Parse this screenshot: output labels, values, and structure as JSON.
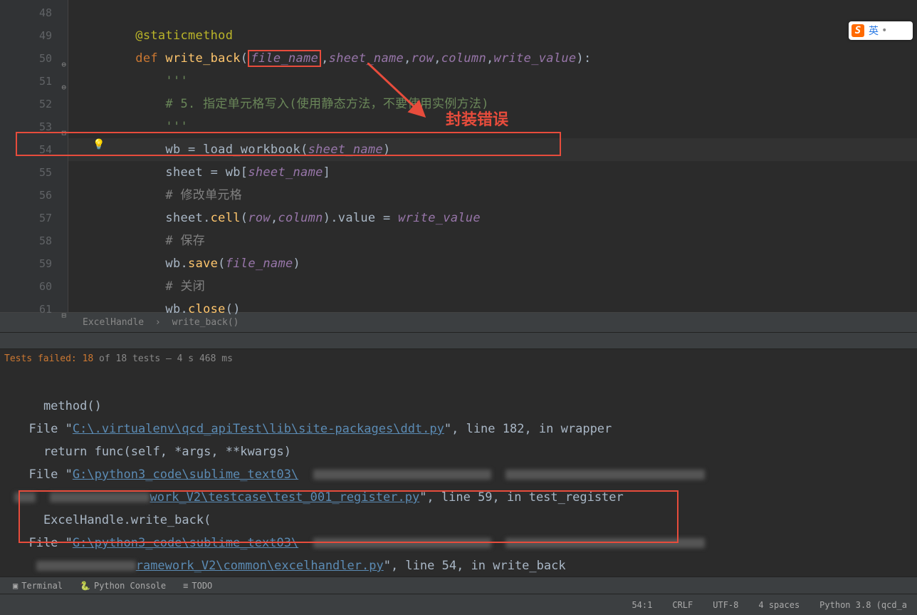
{
  "gutter": [
    "48",
    "49",
    "50",
    "51",
    "52",
    "53",
    "54",
    "55",
    "56",
    "57",
    "58",
    "59",
    "60",
    "61"
  ],
  "code": {
    "l49_decorator": "@staticmethod",
    "l50_def": "def ",
    "l50_func": "write_back",
    "l50_p1": "file_name",
    "l50_p2": "sheet_name",
    "l50_p3": "row",
    "l50_p4": "column",
    "l50_p5": "write_value",
    "l51_doc": "'''",
    "l52_comment": "# 5. 指定单元格写入(使用静态方法，不要使用实例方法)",
    "l53_doc": "'''",
    "l54_wb": "wb ",
    "l54_eq": "= ",
    "l54_fn": "load_workbook",
    "l54_arg": "sheet_name",
    "l55": "sheet = wb[",
    "l55_arg": "sheet_name",
    "l56_comment": "# 修改单元格",
    "l57_a": "sheet.",
    "l57_cell": "cell",
    "l57_p1": "row",
    "l57_p2": "column",
    "l57_val": ".value = ",
    "l57_wv": "write_value",
    "l58_comment": "# 保存",
    "l59_a": "wb.",
    "l59_save": "save",
    "l59_arg": "file_name",
    "l60_comment": "# 关闭",
    "l61_a": "wb.",
    "l61_close": "close",
    "l61_par": "()"
  },
  "annotation_text": "封装错误",
  "breadcrumb": {
    "a": "ExcelHandle",
    "sep": "›",
    "b": "write_back()"
  },
  "tests": {
    "label": "Tests failed: ",
    "failed": "18",
    "total": " of 18 tests",
    "time": " – 4 s 468 ms"
  },
  "console": {
    "l0": "    method()",
    "l1a": "  File \"",
    "l1link": "C:\\.virtualenv\\qcd_apiTest\\lib\\site-packages\\ddt.py",
    "l1b": "\", line 182, in wrapper",
    "l2": "    return func(self, *args, **kwargs)",
    "l3a": "  File \"",
    "l3link": "G:\\python3_code\\sublime_text03\\",
    "l4a": "work_V2\\testcase\\test_001_register.py",
    "l4b": "\", line 59, in test_register",
    "l5": "    ExcelHandle.write_back(",
    "l6a": "  File \"",
    "l6link": "G:\\python3_code\\sublime_text03\\",
    "l7a": "ramework_V2\\common\\excelhandler.py",
    "l7b": "\", line 54, in write_back"
  },
  "bottom_tabs": {
    "terminal": "Terminal",
    "pyconsole": "Python Console",
    "todo": "TODO"
  },
  "status": {
    "pos": "54:1",
    "sep": "CRLF",
    "enc": "UTF-8",
    "indent": "4 spaces",
    "interp": "Python 3.8 (qcd_a"
  },
  "ime": {
    "s": "S",
    "lang": "英"
  }
}
